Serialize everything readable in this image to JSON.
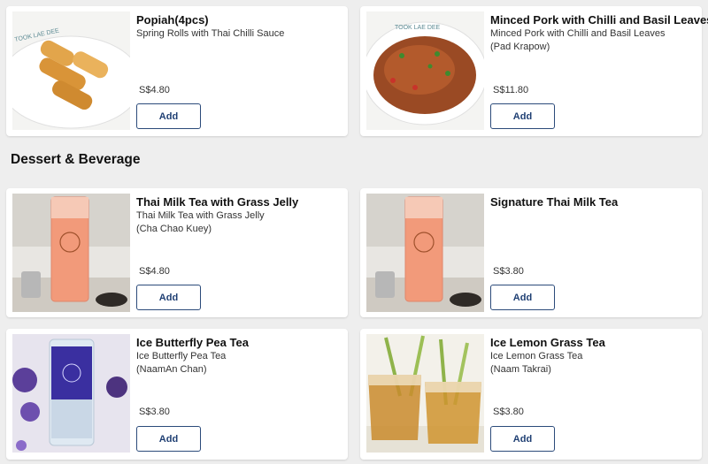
{
  "top_items": [
    {
      "name": "Popiah(4pcs)",
      "desc1": "Spring Rolls with Thai Chilli Sauce",
      "desc2": "",
      "price": "S$4.80",
      "add_label": "Add",
      "image_icon": "spring-rolls-image",
      "plate_text": "TOOK LAE DEE"
    },
    {
      "name": "Minced Pork with Chilli and Basil Leaves",
      "desc1": "Minced Pork with Chilli and Basil Leaves",
      "desc2": "(Pad Krapow)",
      "price": "S$11.80",
      "add_label": "Add",
      "image_icon": "minced-pork-image",
      "plate_text": "TOOK LAE DEE"
    }
  ],
  "section": {
    "title": "Dessert & Beverage"
  },
  "dessert_items": [
    {
      "name": "Thai Milk Tea with Grass Jelly",
      "desc1": "Thai Milk Tea with Grass Jelly",
      "desc2": "(Cha Chao Kuey)",
      "price": "S$4.80",
      "add_label": "Add",
      "image_icon": "thai-milk-tea-image"
    },
    {
      "name": "Signature Thai Milk Tea",
      "desc1": "",
      "desc2": "",
      "price": "S$3.80",
      "add_label": "Add",
      "image_icon": "thai-milk-tea-image"
    },
    {
      "name": "Ice Butterfly Pea Tea",
      "desc1": "Ice Butterfly Pea Tea",
      "desc2": "(NaamAn Chan)",
      "price": "S$3.80",
      "add_label": "Add",
      "image_icon": "butterfly-pea-tea-image"
    },
    {
      "name": "Ice Lemon Grass Tea",
      "desc1": "Ice Lemon Grass Tea",
      "desc2": "(Naam Takrai)",
      "price": "S$3.80",
      "add_label": "Add",
      "image_icon": "lemon-grass-tea-image"
    }
  ],
  "colors": {
    "background": "#eeeeee",
    "card": "#ffffff",
    "button_border": "#2b4a7a",
    "button_text": "#1f3f73"
  }
}
